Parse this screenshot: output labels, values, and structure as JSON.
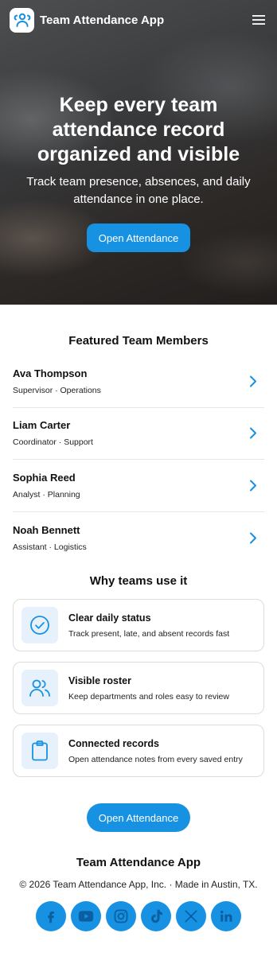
{
  "app": {
    "name": "Team Attendance App"
  },
  "header": {
    "logo_icon": "users-icon",
    "menu_icon": "hamburger-icon"
  },
  "hero": {
    "title": "Keep every team attendance record organized and visible",
    "subtitle": "Track team presence, absences, and daily attendance in one place.",
    "cta_label": "Open Attendance"
  },
  "featured": {
    "title": "Featured Team Members",
    "members": [
      {
        "name": "Ava Thompson",
        "role": "Supervisor · Operations"
      },
      {
        "name": "Liam Carter",
        "role": "Coordinator · Support"
      },
      {
        "name": "Sophia Reed",
        "role": "Analyst · Planning"
      },
      {
        "name": "Noah Bennett",
        "role": "Assistant · Logistics"
      }
    ]
  },
  "why": {
    "title": "Why teams use it",
    "cards": [
      {
        "icon": "check-circle-icon",
        "title": "Clear daily status",
        "desc": "Track present, late, and absent records fast"
      },
      {
        "icon": "users-icon",
        "title": "Visible roster",
        "desc": "Keep departments and roles easy to review"
      },
      {
        "icon": "clipboard-icon",
        "title": "Connected records",
        "desc": "Open attendance notes from every saved entry"
      }
    ]
  },
  "bottom_cta": {
    "label": "Open Attendance"
  },
  "footer": {
    "brand": "Team Attendance App",
    "copyright": "© 2026 Team Attendance App, Inc. · Made in Austin, TX.",
    "socials": [
      "facebook-icon",
      "youtube-icon",
      "instagram-icon",
      "tiktok-icon",
      "x-icon",
      "linkedin-icon"
    ]
  },
  "colors": {
    "accent": "#1792e2",
    "card_icon_bg": "#e6f1fb",
    "border": "#dcdcdc"
  }
}
